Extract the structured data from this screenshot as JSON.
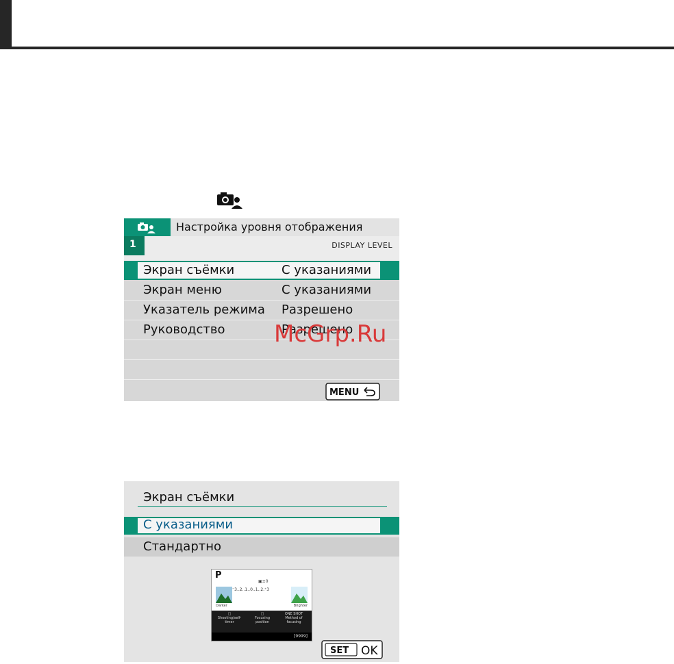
{
  "page": {
    "header_visible": true
  },
  "menu_screen": {
    "title": "Настройка уровня отображения",
    "page_number": "1",
    "level_label": "DISPLAY LEVEL",
    "rows": [
      {
        "label": "Экран съёмки",
        "value": "С указаниями",
        "selected": true
      },
      {
        "label": "Экран меню",
        "value": "С указаниями",
        "selected": false
      },
      {
        "label": "Указатель режима",
        "value": "Разрешено",
        "selected": false
      },
      {
        "label": "Руководство",
        "value": "Разрешено",
        "selected": false
      }
    ],
    "menu_button": "MENU"
  },
  "watermark": "McGrp.Ru",
  "option_screen": {
    "title": "Экран съёмки",
    "options": [
      "С указаниями",
      "Стандартно"
    ],
    "preview": {
      "mode": "P",
      "ev_label": "▣±0",
      "scale": "⁻3..2..1..0..1..2.⁺3",
      "darker": "Darker",
      "brighter": "Brighter",
      "col1_top": "□",
      "col1_bottom": "Shooting/self-timer",
      "col2_top": "□",
      "col2_bottom": "Focusing position",
      "col3_top": "ONE SHOT",
      "col3_bottom": "Method of focusing",
      "shots": "[9999]"
    },
    "set_button": "SET",
    "ok_label": "OK"
  },
  "colors": {
    "accent": "#0b9276",
    "watermark": "#d93a3a"
  }
}
